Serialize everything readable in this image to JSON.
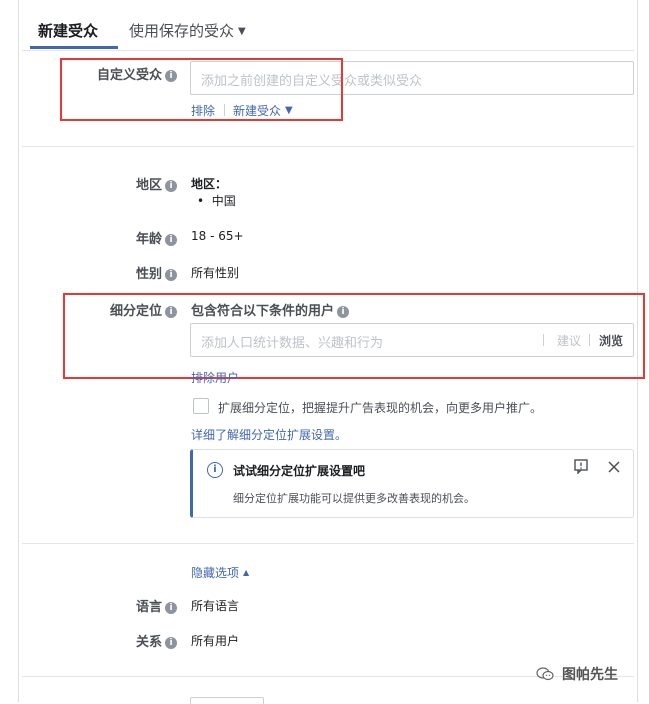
{
  "tabs": {
    "new_audience": "新建受众",
    "saved_audience": "使用保存的受众"
  },
  "custom_audience": {
    "label": "自定义受众",
    "placeholder": "添加之前创建的自定义受众或类似受众",
    "exclude_link": "排除",
    "create_link": "新建受众"
  },
  "location": {
    "label": "地区",
    "title": "地区：",
    "item": "中国"
  },
  "age": {
    "label": "年龄",
    "value": "18 - 65+"
  },
  "gender": {
    "label": "性别",
    "value": "所有性别"
  },
  "detailed_targeting": {
    "label": "细分定位",
    "heading": "包含符合以下条件的用户",
    "placeholder": "添加人口统计数据、兴趣和行为",
    "suggest": "建议",
    "browse": "浏览",
    "exclude_people": "排除用户",
    "expand_checkbox_label": "扩展细分定位，把握提升广告表现的机会，向更多用户推广。",
    "learn_more": "详细了解细分定位扩展设置。"
  },
  "notice": {
    "title": "试试细分定位扩展设置吧",
    "body": "细分定位扩展功能可以提供更多改善表现的机会。"
  },
  "hide_options": "隐藏选项",
  "languages": {
    "label": "语言",
    "value": "所有语言"
  },
  "connections": {
    "label": "关系",
    "value": "所有用户"
  },
  "wechat_watermark": "图帕先生",
  "colors": {
    "accent": "#4267b2",
    "highlight": "#e53935"
  }
}
